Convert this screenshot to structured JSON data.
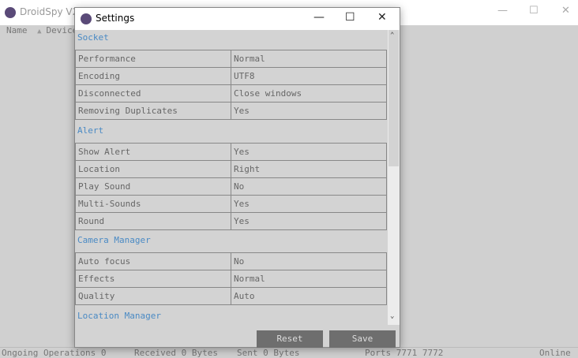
{
  "main_window": {
    "title": "DroidSpy V2",
    "columns": [
      "Name",
      "Device"
    ]
  },
  "status_bar": {
    "ongoing": "Ongoing Operations 0",
    "received": "Received 0 Bytes",
    "sent": "Sent 0 Bytes",
    "ports": "Ports 7771 7772",
    "online": "Online"
  },
  "dialog": {
    "title": "Settings",
    "sections": [
      {
        "title": "Socket",
        "rows": [
          [
            "Performance",
            "Normal"
          ],
          [
            "Encoding",
            "UTF8"
          ],
          [
            "Disconnected",
            "Close windows"
          ],
          [
            "Removing Duplicates",
            "Yes"
          ]
        ]
      },
      {
        "title": "Alert",
        "rows": [
          [
            "Show Alert",
            "Yes"
          ],
          [
            "Location",
            "Right"
          ],
          [
            "Play Sound",
            "No"
          ],
          [
            "Multi-Sounds",
            "Yes"
          ],
          [
            "Round",
            "Yes"
          ]
        ]
      },
      {
        "title": "Camera Manager",
        "rows": [
          [
            "Auto focus",
            "No"
          ],
          [
            "Effects",
            "Normal"
          ],
          [
            "Quality",
            "Auto"
          ]
        ]
      },
      {
        "title": "Location Manager",
        "rows": []
      }
    ],
    "reset_label": "Reset",
    "save_label": "Save",
    "scroll_position": 0
  },
  "colors": {
    "section": "#4a8ac4",
    "button": "#6e6e6e"
  }
}
